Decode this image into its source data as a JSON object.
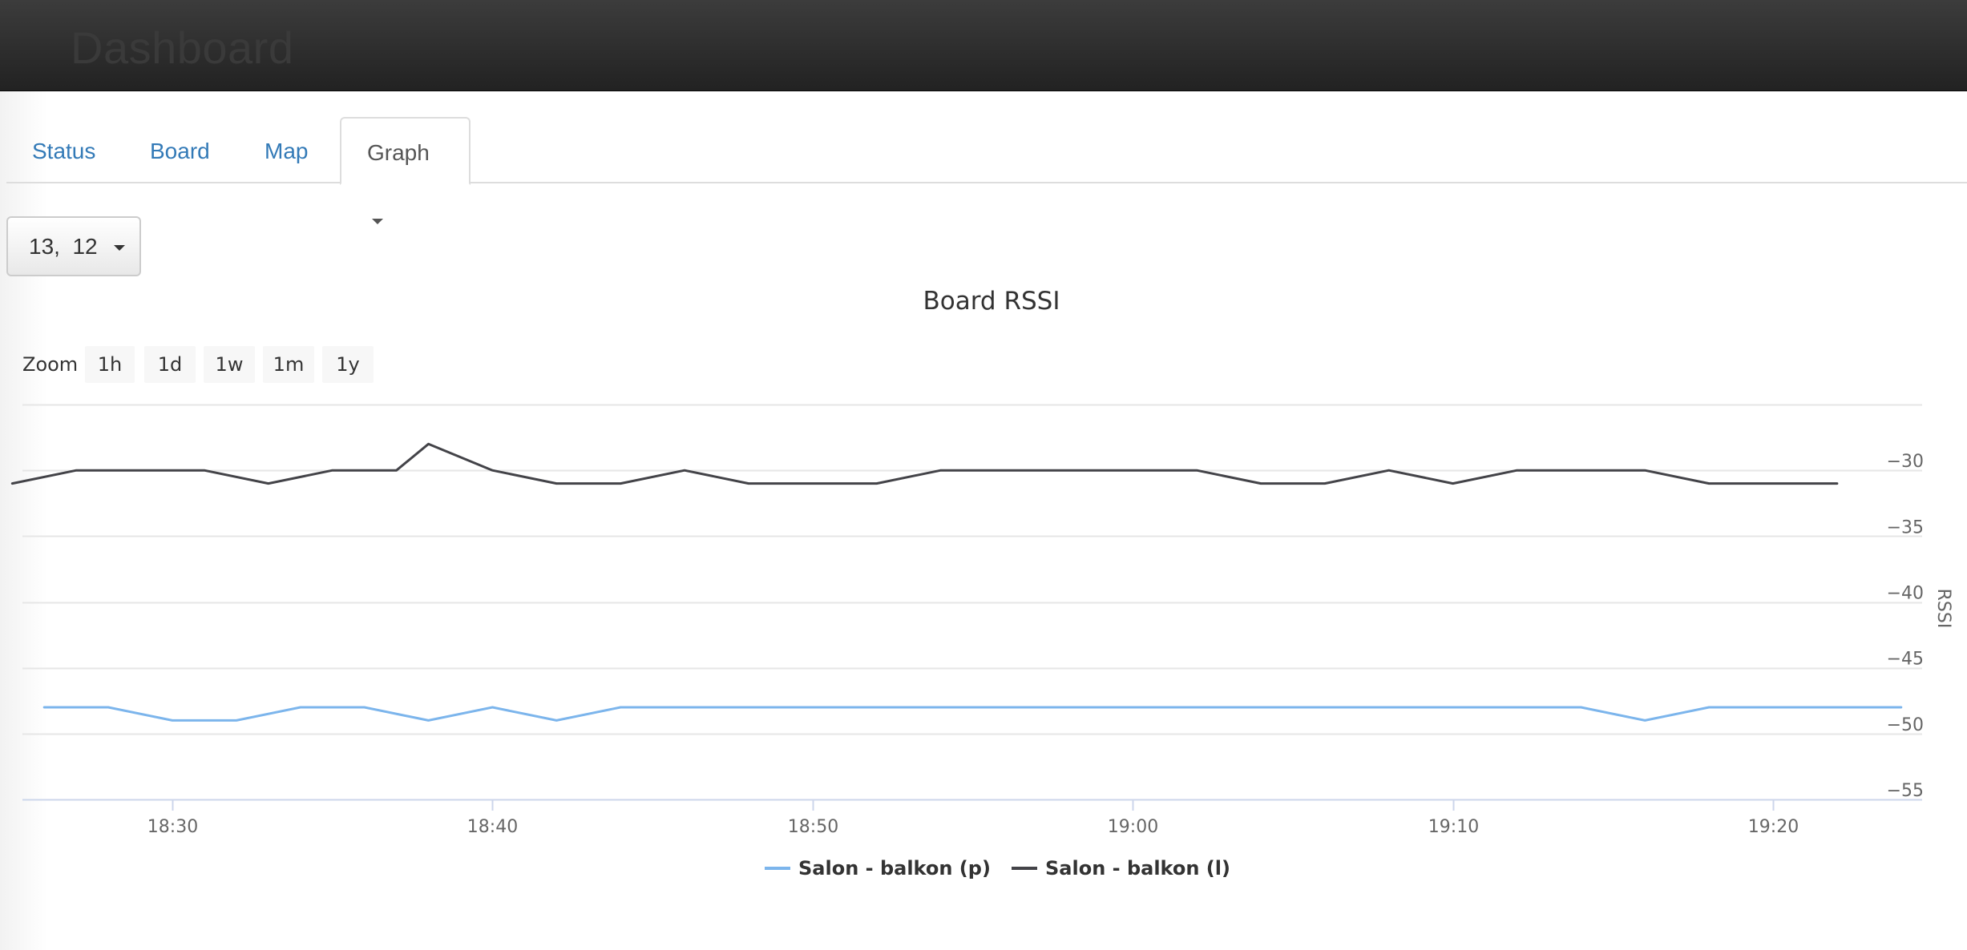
{
  "header": {
    "brand": "Dashboard"
  },
  "tabs": [
    {
      "label": "Status"
    },
    {
      "label": "Board"
    },
    {
      "label": "Map"
    },
    {
      "label": "Graph"
    }
  ],
  "board_select": {
    "value": "13,  12"
  },
  "zoom": {
    "label": "Zoom",
    "buttons": [
      "1h",
      "1d",
      "1w",
      "1m",
      "1y"
    ]
  },
  "colors": {
    "link": "#337ab7",
    "series_p": "#7cb5ec",
    "series_l": "#434348"
  },
  "chart_data": {
    "type": "line",
    "title": "Board RSSI",
    "ylabel": "RSSI",
    "ylim": [
      -55,
      -25
    ],
    "yticks": [
      -30,
      -35,
      -40,
      -45,
      -50,
      -55
    ],
    "xticks": [
      "18:30",
      "18:40",
      "18:50",
      "19:00",
      "19:10",
      "19:20"
    ],
    "legend": "bottom-center",
    "series": [
      {
        "name": "Salon - balkon (p)",
        "color": "#7cb5ec",
        "points": [
          [
            "18:26",
            -48
          ],
          [
            "18:28",
            -48
          ],
          [
            "18:30",
            -49
          ],
          [
            "18:32",
            -49
          ],
          [
            "18:34",
            -48
          ],
          [
            "18:36",
            -48
          ],
          [
            "18:38",
            -49
          ],
          [
            "18:40",
            -48
          ],
          [
            "18:42",
            -49
          ],
          [
            "18:44",
            -48
          ],
          [
            "18:46",
            -48
          ],
          [
            "18:48",
            -48
          ],
          [
            "18:50",
            -48
          ],
          [
            "18:52",
            -48
          ],
          [
            "18:54",
            -48
          ],
          [
            "18:56",
            -48
          ],
          [
            "18:58",
            -48
          ],
          [
            "19:00",
            -48
          ],
          [
            "19:02",
            -48
          ],
          [
            "19:04",
            -48
          ],
          [
            "19:06",
            -48
          ],
          [
            "19:08",
            -48
          ],
          [
            "19:10",
            -48
          ],
          [
            "19:12",
            -48
          ],
          [
            "19:14",
            -48
          ],
          [
            "19:16",
            -49
          ],
          [
            "19:18",
            -48
          ],
          [
            "19:20",
            -48
          ],
          [
            "19:22",
            -48
          ],
          [
            "19:24",
            -48
          ]
        ]
      },
      {
        "name": "Salon - balkon (l)",
        "color": "#434348",
        "points": [
          [
            "18:25",
            -31
          ],
          [
            "18:27",
            -30
          ],
          [
            "18:29",
            -30
          ],
          [
            "18:31",
            -30
          ],
          [
            "18:33",
            -31
          ],
          [
            "18:35",
            -30
          ],
          [
            "18:37",
            -30
          ],
          [
            "18:38",
            -28
          ],
          [
            "18:40",
            -30
          ],
          [
            "18:42",
            -31
          ],
          [
            "18:44",
            -31
          ],
          [
            "18:46",
            -30
          ],
          [
            "18:48",
            -31
          ],
          [
            "18:50",
            -31
          ],
          [
            "18:52",
            -31
          ],
          [
            "18:54",
            -30
          ],
          [
            "18:56",
            -30
          ],
          [
            "18:58",
            -30
          ],
          [
            "19:00",
            -30
          ],
          [
            "19:02",
            -30
          ],
          [
            "19:04",
            -31
          ],
          [
            "19:06",
            -31
          ],
          [
            "19:08",
            -30
          ],
          [
            "19:10",
            -31
          ],
          [
            "19:12",
            -30
          ],
          [
            "19:14",
            -30
          ],
          [
            "19:16",
            -30
          ],
          [
            "19:18",
            -31
          ],
          [
            "19:20",
            -31
          ],
          [
            "19:22",
            -31
          ]
        ]
      }
    ]
  }
}
